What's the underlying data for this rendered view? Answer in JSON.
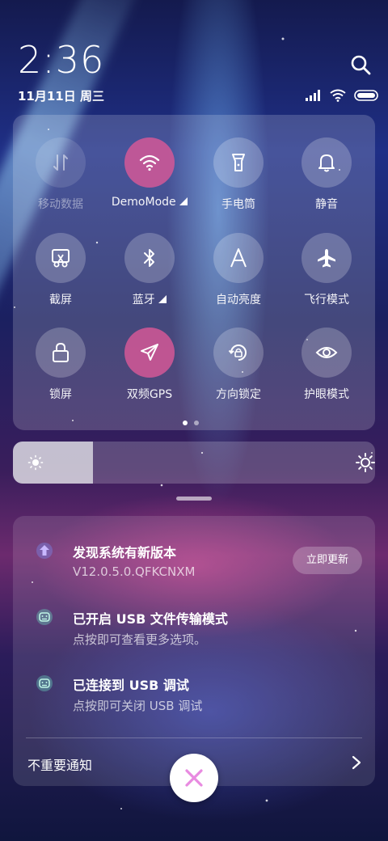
{
  "status_bar": {
    "time": "2:36",
    "date": "11月11日 周三"
  },
  "quick_settings": {
    "tiles": [
      {
        "label": "移动数据",
        "icon": "mobile-data-icon",
        "state": "disabled"
      },
      {
        "label": "DemoMode",
        "icon": "wifi-icon",
        "state": "active"
      },
      {
        "label": "手电筒",
        "icon": "flashlight-icon",
        "state": "off"
      },
      {
        "label": "静音",
        "icon": "bell-icon",
        "state": "off"
      },
      {
        "label": "截屏",
        "icon": "screenshot-icon",
        "state": "off"
      },
      {
        "label": "蓝牙",
        "icon": "bluetooth-icon",
        "state": "off"
      },
      {
        "label": "自动亮度",
        "icon": "auto-brightness-icon",
        "state": "off"
      },
      {
        "label": "飞行模式",
        "icon": "airplane-icon",
        "state": "off"
      },
      {
        "label": "锁屏",
        "icon": "lock-icon",
        "state": "off"
      },
      {
        "label": "双频GPS",
        "icon": "gps-icon",
        "state": "active"
      },
      {
        "label": "方向锁定",
        "icon": "rotation-lock-icon",
        "state": "off"
      },
      {
        "label": "护眼模式",
        "icon": "eye-icon",
        "state": "off"
      }
    ],
    "page_index": 1,
    "page_count": 2
  },
  "brightness": {
    "level": 0.22
  },
  "notifications": [
    {
      "title": "发现系统有新版本",
      "subtitle": "V12.0.5.0.QFKCNXM",
      "icon": "system-update-icon",
      "action": "立即更新"
    },
    {
      "title": "已开启 USB 文件传输模式",
      "subtitle": "点按即可查看更多选项。",
      "icon": "android-icon"
    },
    {
      "title": "已连接到 USB 调试",
      "subtitle": "点按即可关闭 USB 调试",
      "icon": "android-icon"
    }
  ],
  "unimportant_label": "不重要通知",
  "colors": {
    "active_tile": "#d45896",
    "clear_button_x": "#e88ae0"
  }
}
